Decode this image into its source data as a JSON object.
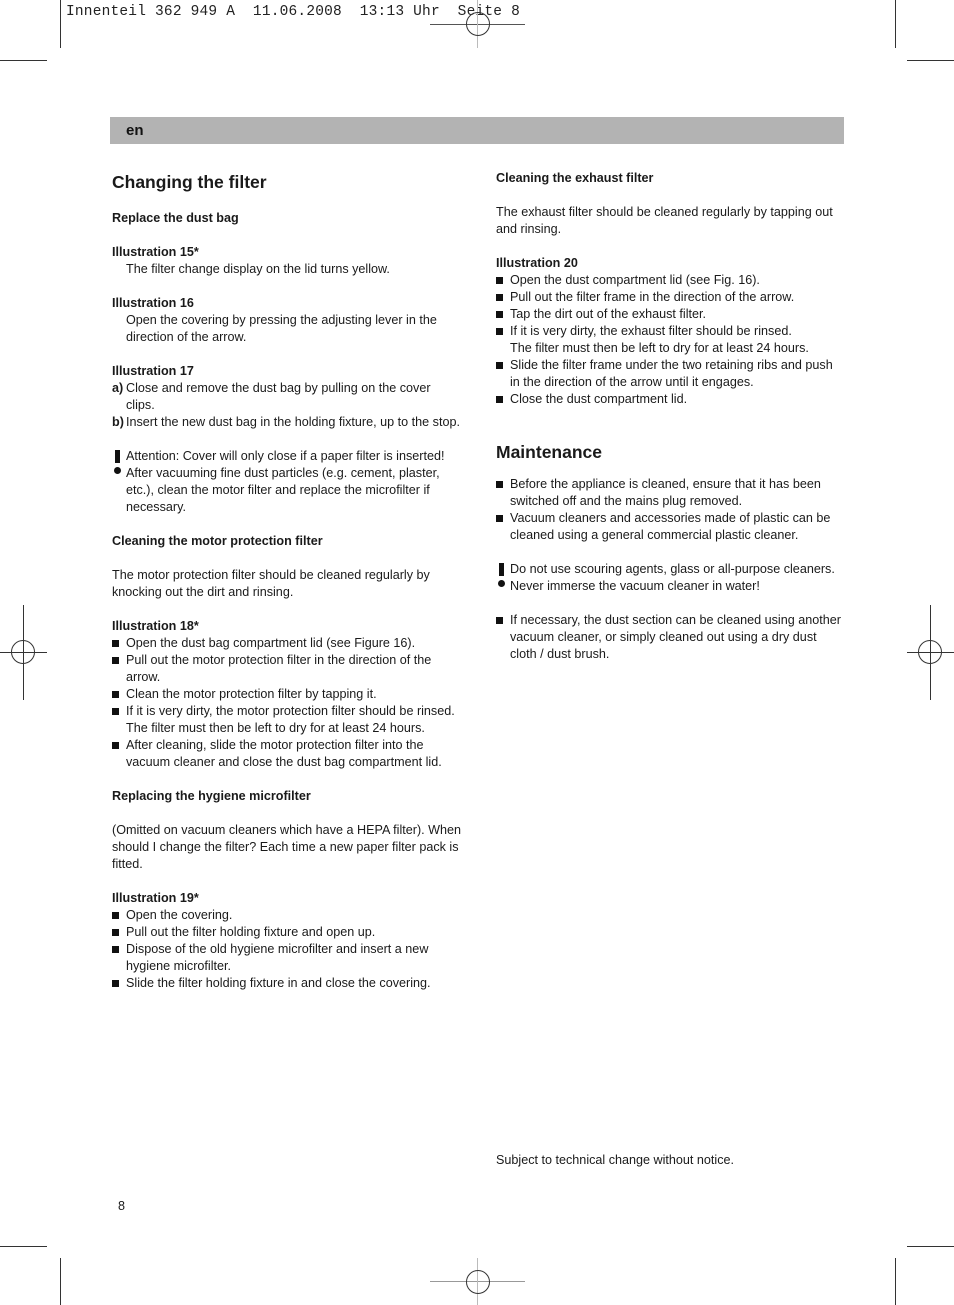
{
  "slug": "Innenteil 362 949 A  11.06.2008  13:13 Uhr  Seite 8",
  "language_tab": "en",
  "left": {
    "title": "Changing the filter",
    "replace_dust_bag": {
      "heading": "Replace the dust bag",
      "ill15": {
        "label": "Illustration 15*",
        "text": "The filter change display on the lid turns yellow."
      },
      "ill16": {
        "label": "Illustration 16",
        "text": "Open the covering by pressing the adjusting lever in the direction of the arrow."
      },
      "ill17": {
        "label": "Illustration 17",
        "items": [
          {
            "letter": "a)",
            "text": "Close and remove the dust bag by pulling on the cover clips."
          },
          {
            "letter": "b)",
            "text": "Insert the new dust bag in the holding fixture, up to the stop."
          }
        ]
      },
      "warning": "Attention: Cover will only close if a paper filter is inserted! After vacuuming fine dust particles (e.g. cement, plaster, etc.), clean the motor filter and replace the microfilter if necessary."
    },
    "motor_filter": {
      "heading": "Cleaning the motor protection filter",
      "intro": "The motor protection filter should be cleaned regularly by knocking out the dirt and rinsing.",
      "ill_label": "Illustration 18*",
      "items": [
        "Open the dust bag compartment lid (see Figure 16).",
        "Pull out the motor protection filter in the direction of the arrow.",
        "Clean the motor protection filter by tapping it.",
        "If it is very dirty, the motor protection filter should be rinsed.",
        "After cleaning, slide the motor protection filter into the vacuum cleaner and close the dust bag compartment lid."
      ],
      "note": "The filter must then be left to dry for at least 24 hours."
    },
    "microfilter": {
      "heading": "Replacing the hygiene microfilter",
      "intro": "(Omitted on vacuum cleaners which have a HEPA filter). When should I change the filter? Each time a new paper filter pack is fitted.",
      "ill_label": "Illustration 19*",
      "items": [
        "Open the covering.",
        "Pull out the filter holding fixture and open up.",
        "Dispose of the old hygiene microfilter and insert a new hygiene microfilter.",
        "Slide the filter holding fixture in and close the covering."
      ]
    }
  },
  "right": {
    "exhaust": {
      "heading": "Cleaning the exhaust filter",
      "intro": "The exhaust filter should be cleaned regularly by tapping out and rinsing.",
      "ill_label": "Illustration 20",
      "items": [
        "Open the dust compartment lid (see Fig. 16).",
        "Pull out the filter frame in the direction of the arrow.",
        "Tap the dirt out of the exhaust filter.",
        "If it is very dirty, the exhaust filter should be rinsed.",
        "Slide the filter frame under the two retaining ribs and push in the direction of the arrow until it engages.",
        "Close the dust compartment lid."
      ],
      "note": "The filter must then be left to dry for at least 24 hours."
    },
    "maintenance": {
      "title": "Maintenance",
      "items": [
        "Before the appliance is cleaned, ensure that it has been switched off and the mains plug removed.",
        "Vacuum cleaners and accessories made of plastic can be cleaned using a general commercial plastic cleaner."
      ],
      "warning_line1": "Do not use scouring agents, glass or all-purpose cleaners.",
      "warning_line2": "Never immerse the vacuum cleaner in water!",
      "last_item": "If necessary, the dust section can be cleaned using another vacuum cleaner, or simply cleaned out using a dry dust cloth / dust brush."
    }
  },
  "footer_note": "Subject to technical change without notice.",
  "page_number": "8"
}
